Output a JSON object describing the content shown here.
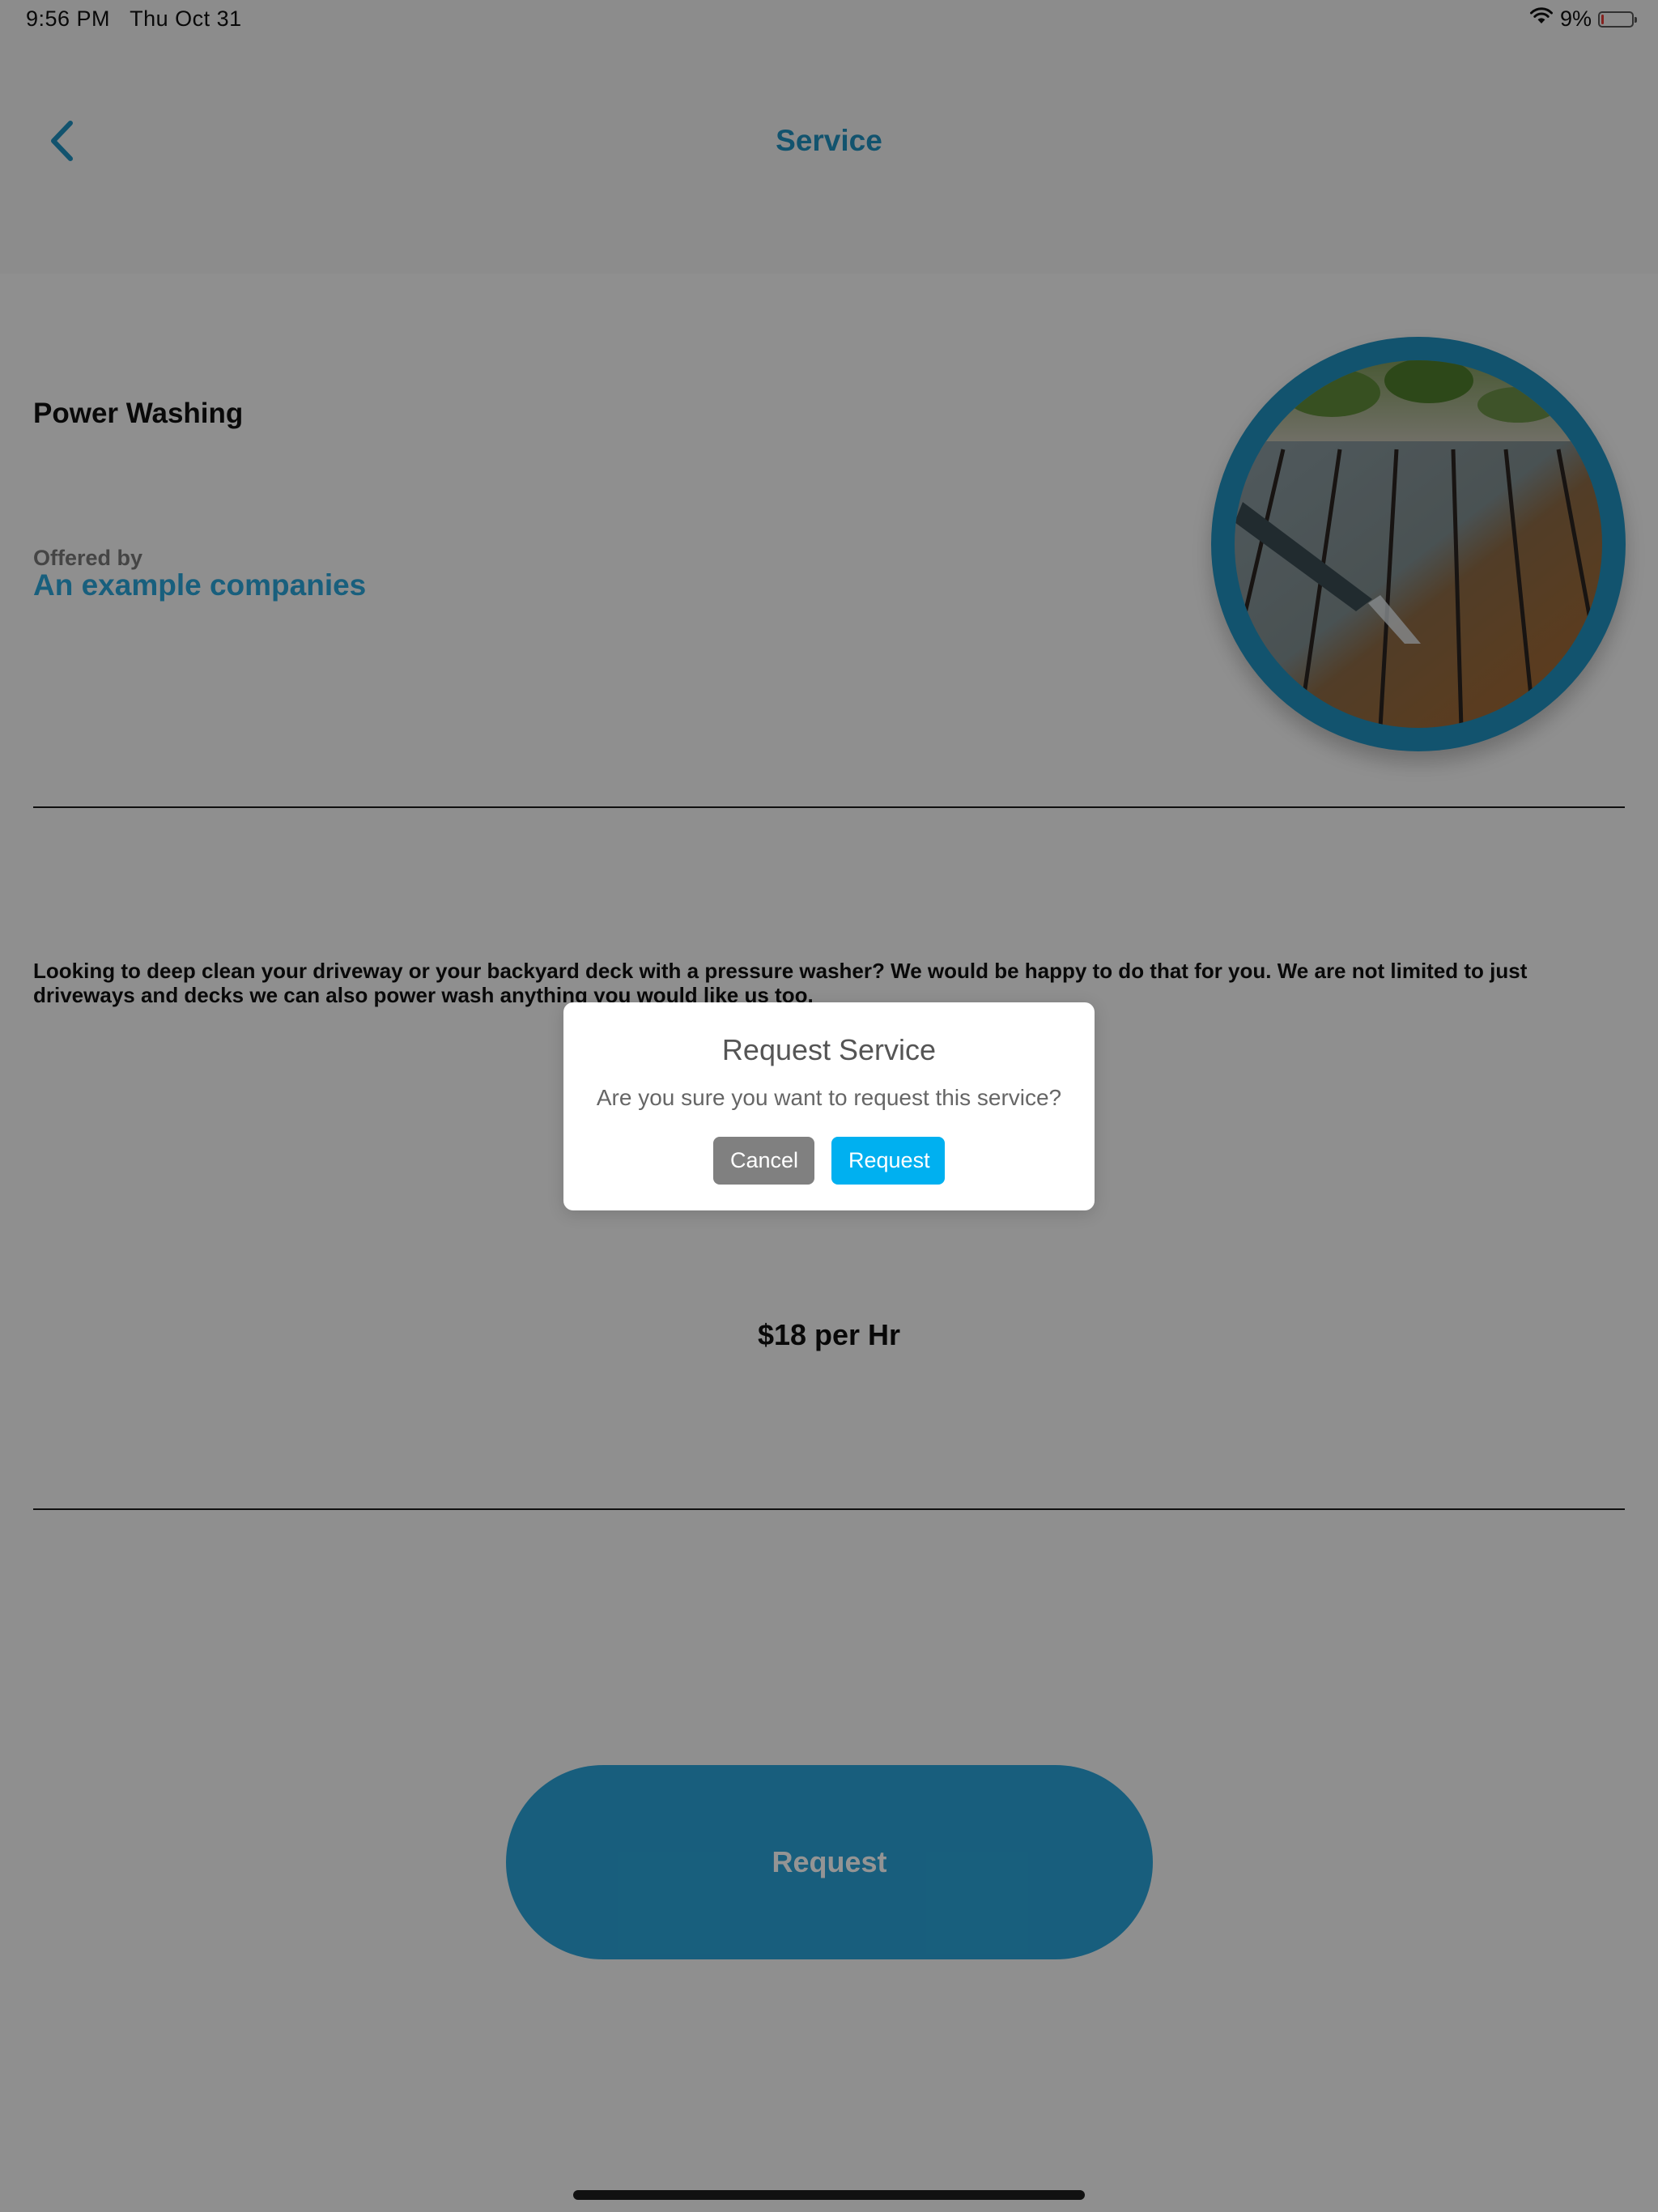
{
  "status_bar": {
    "time": "9:56 PM",
    "date": "Thu Oct 31",
    "battery_percent": "9%",
    "battery_level": 0.09,
    "icons": [
      "wifi-icon",
      "battery-icon"
    ]
  },
  "nav": {
    "title": "Service",
    "back_icon": "chevron-left-icon"
  },
  "service": {
    "name": "Power Washing",
    "offered_by_label": "Offered by",
    "company": "An example companies",
    "description": "Looking to deep clean your driveway or your backyard deck with a pressure washer? We would be happy to do that for you. We are not limited to just driveways and decks we can also power wash anything you would like us too.",
    "price": "$18 per Hr",
    "request_label": "Request"
  },
  "dialog": {
    "title": "Request Service",
    "message": "Are you sure you want to request this service?",
    "cancel_label": "Cancel",
    "request_label": "Request"
  },
  "colors": {
    "accent": "#1f8fbd",
    "link": "#2aa4d8",
    "dialog_request": "#00b0f0",
    "dialog_cancel": "#808080",
    "battery_low": "#e53935"
  }
}
